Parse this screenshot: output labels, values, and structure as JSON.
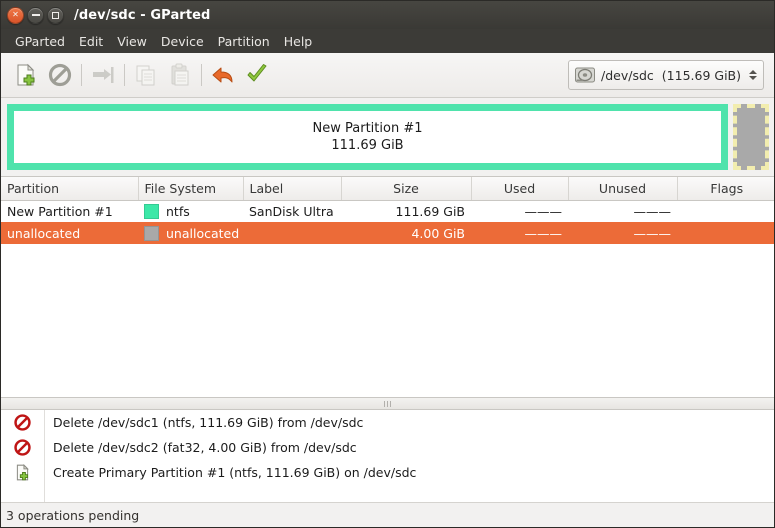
{
  "window": {
    "title": "/dev/sdc - GParted",
    "buttons": {
      "close": "close-button",
      "minimize": "minimize-button",
      "maximize": "maximize-button"
    }
  },
  "menubar": {
    "items": [
      {
        "label": "GParted"
      },
      {
        "label": "Edit"
      },
      {
        "label": "View"
      },
      {
        "label": "Device"
      },
      {
        "label": "Partition"
      },
      {
        "label": "Help"
      }
    ]
  },
  "toolbar": {
    "buttons": [
      {
        "name": "new-partition-button",
        "icon": "new-document-icon",
        "enabled": true
      },
      {
        "name": "delete-partition-button",
        "icon": "delete-prohibition-icon",
        "enabled": true
      },
      {
        "name": "resize-move-button",
        "icon": "resize-move-icon",
        "enabled": false
      },
      {
        "name": "copy-button",
        "icon": "copy-icon",
        "enabled": false
      },
      {
        "name": "paste-button",
        "icon": "paste-icon",
        "enabled": false
      },
      {
        "name": "undo-button",
        "icon": "undo-arrow-icon",
        "enabled": true
      },
      {
        "name": "apply-button",
        "icon": "apply-check-icon",
        "enabled": true
      }
    ],
    "device_selector": {
      "icon": "hard-disk-icon",
      "device": "/dev/sdc",
      "size": "(115.69 GiB)"
    }
  },
  "graphic": {
    "partition": {
      "name": "New Partition #1",
      "size": "111.69 GiB",
      "border_color": "#4fe3ac",
      "fill_color": "#ffffff"
    },
    "unallocated": {
      "fill_color": "#a9a9a9",
      "border_color": "#f2edaf"
    }
  },
  "table": {
    "columns": [
      {
        "label": "Partition",
        "align": "left"
      },
      {
        "label": "File System",
        "align": "left"
      },
      {
        "label": "Label",
        "align": "left"
      },
      {
        "label": "Size",
        "align": "center"
      },
      {
        "label": "Used",
        "align": "center"
      },
      {
        "label": "Unused",
        "align": "center"
      },
      {
        "label": "Flags",
        "align": "center"
      }
    ],
    "rows": [
      {
        "partition": "New Partition #1",
        "filesystem": "ntfs",
        "swatch": "#3ce8a8",
        "label": "SanDisk Ultra",
        "size": "111.69 GiB",
        "used": "———",
        "unused": "———",
        "flags": "",
        "selected": false
      },
      {
        "partition": "unallocated",
        "filesystem": "unallocated",
        "swatch": "#a9a9a9",
        "label": "",
        "size": "4.00 GiB",
        "used": "———",
        "unused": "———",
        "flags": "",
        "selected": true
      }
    ],
    "selection_color": "#ec6b38"
  },
  "operations": [
    {
      "icon": "delete-prohibition-icon",
      "text": "Delete /dev/sdc1 (ntfs, 111.69 GiB) from /dev/sdc"
    },
    {
      "icon": "delete-prohibition-icon",
      "text": "Delete /dev/sdc2 (fat32, 4.00 GiB) from /dev/sdc"
    },
    {
      "icon": "new-document-icon",
      "text": "Create Primary Partition #1 (ntfs, 111.69 GiB) on /dev/sdc"
    }
  ],
  "statusbar": {
    "text": "3 operations pending"
  }
}
